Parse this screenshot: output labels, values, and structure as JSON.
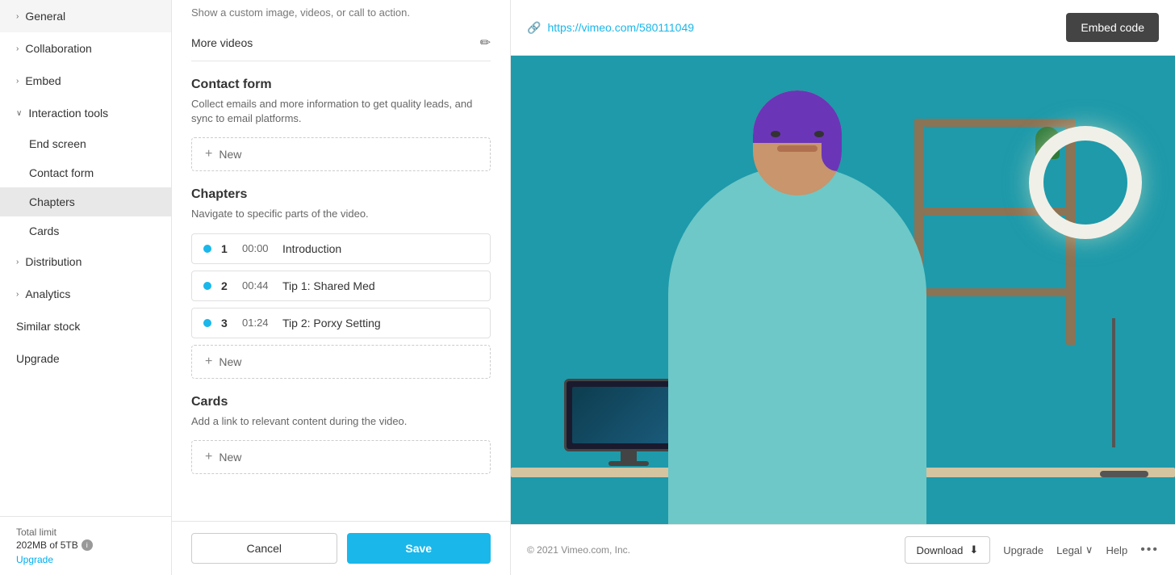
{
  "sidebar": {
    "items": [
      {
        "id": "general",
        "label": "General",
        "type": "expandable",
        "expanded": false
      },
      {
        "id": "collaboration",
        "label": "Collaboration",
        "type": "expandable",
        "expanded": false
      },
      {
        "id": "embed",
        "label": "Embed",
        "type": "expandable",
        "expanded": false
      },
      {
        "id": "interaction-tools",
        "label": "Interaction tools",
        "type": "expandable",
        "expanded": true
      },
      {
        "id": "end-screen",
        "label": "End screen",
        "type": "sub"
      },
      {
        "id": "contact-form",
        "label": "Contact form",
        "type": "sub"
      },
      {
        "id": "chapters",
        "label": "Chapters",
        "type": "sub",
        "active": true
      },
      {
        "id": "cards",
        "label": "Cards",
        "type": "sub"
      },
      {
        "id": "distribution",
        "label": "Distribution",
        "type": "expandable",
        "expanded": false
      },
      {
        "id": "analytics",
        "label": "Analytics",
        "type": "expandable",
        "expanded": false
      },
      {
        "id": "similar-stock",
        "label": "Similar stock",
        "type": "plain"
      },
      {
        "id": "upgrade",
        "label": "Upgrade",
        "type": "plain"
      }
    ],
    "footer": {
      "total_limit_label": "Total limit",
      "usage": "202MB of 5TB",
      "upgrade_label": "Upgrade"
    }
  },
  "middle": {
    "more_videos": {
      "label": "More videos"
    },
    "contact_form": {
      "title": "Contact form",
      "description": "Collect emails and more information to get quality leads, and sync to email platforms.",
      "add_label": "New"
    },
    "chapters": {
      "title": "Chapters",
      "description": "Navigate to specific parts of the video.",
      "items": [
        {
          "num": "1",
          "time": "00:00",
          "name": "Introduction"
        },
        {
          "num": "2",
          "time": "00:44",
          "name": "Tip 1: Shared Med"
        },
        {
          "num": "3",
          "time": "01:24",
          "name": "Tip 2: Porxy Setting"
        }
      ],
      "add_label": "New"
    },
    "cards": {
      "title": "Cards",
      "description": "Add a link to relevant content during the video.",
      "add_label": "New"
    },
    "cancel_label": "Cancel",
    "save_label": "Save"
  },
  "right": {
    "video_url": "https://vimeo.com/580111049",
    "embed_code_label": "Embed code",
    "download_label": "Download",
    "footer": {
      "copyright": "© 2021 Vimeo.com, Inc.",
      "upgrade_label": "Upgrade",
      "legal_label": "Legal",
      "help_label": "Help"
    }
  }
}
